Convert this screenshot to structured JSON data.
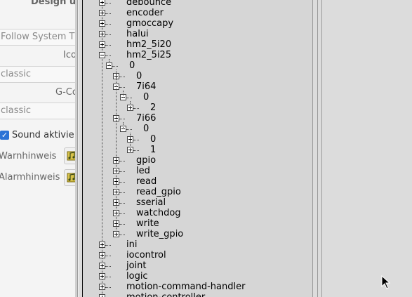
{
  "background_window": {
    "heading": "Design u",
    "theme_select": "Follow System Th",
    "icon_label": "Ico",
    "style_select_1": "classic",
    "gcode_label": "G-Co",
    "style_select_2": "classic",
    "sound_checkbox_label": "Sound aktivie",
    "sound_checkbox_checked": true,
    "warning_label": "Warnhinweis",
    "alarm_label": "Alarmhinweis"
  },
  "tree": {
    "items": [
      {
        "label": "debounce",
        "level": 0,
        "expanded": false
      },
      {
        "label": "encoder",
        "level": 0,
        "expanded": false
      },
      {
        "label": "gmoccapy",
        "level": 0,
        "expanded": false
      },
      {
        "label": "halui",
        "level": 0,
        "expanded": false
      },
      {
        "label": "hm2_5i20",
        "level": 0,
        "expanded": false
      },
      {
        "label": "hm2_5i25",
        "level": 0,
        "expanded": true
      },
      {
        "label": "0",
        "level": 1,
        "expanded": true
      },
      {
        "label": "0",
        "level": 2,
        "expanded": false
      },
      {
        "label": "7i64",
        "level": 2,
        "expanded": true
      },
      {
        "label": "0",
        "level": 3,
        "expanded": true
      },
      {
        "label": "2",
        "level": 4,
        "expanded": false
      },
      {
        "label": "7i66",
        "level": 2,
        "expanded": true
      },
      {
        "label": "0",
        "level": 3,
        "expanded": true
      },
      {
        "label": "0",
        "level": 4,
        "expanded": false
      },
      {
        "label": "1",
        "level": 4,
        "expanded": false
      },
      {
        "label": "gpio",
        "level": 2,
        "expanded": false
      },
      {
        "label": "led",
        "level": 2,
        "expanded": false
      },
      {
        "label": "read",
        "level": 2,
        "expanded": false
      },
      {
        "label": "read_gpio",
        "level": 2,
        "expanded": false
      },
      {
        "label": "sserial",
        "level": 2,
        "expanded": false
      },
      {
        "label": "watchdog",
        "level": 2,
        "expanded": false
      },
      {
        "label": "write",
        "level": 2,
        "expanded": false
      },
      {
        "label": "write_gpio",
        "level": 2,
        "expanded": false
      },
      {
        "label": "ini",
        "level": 0,
        "expanded": false
      },
      {
        "label": "iocontrol",
        "level": 0,
        "expanded": false
      },
      {
        "label": "joint",
        "level": 0,
        "expanded": false
      },
      {
        "label": "logic",
        "level": 0,
        "expanded": false
      },
      {
        "label": "motion-command-handler",
        "level": 0,
        "expanded": false
      },
      {
        "label": "motion-controller",
        "level": 0,
        "expanded": false
      }
    ]
  },
  "colors": {
    "tree_background": "#d6d6d6",
    "window_background": "#dcdcdc",
    "checkbox_accent": "#2b73d6"
  },
  "icons": {
    "expander_collapsed": "plus-box-icon",
    "expander_expanded": "minus-box-icon",
    "sound_button": "music-note-icon",
    "pointer": "mouse-pointer-icon"
  }
}
